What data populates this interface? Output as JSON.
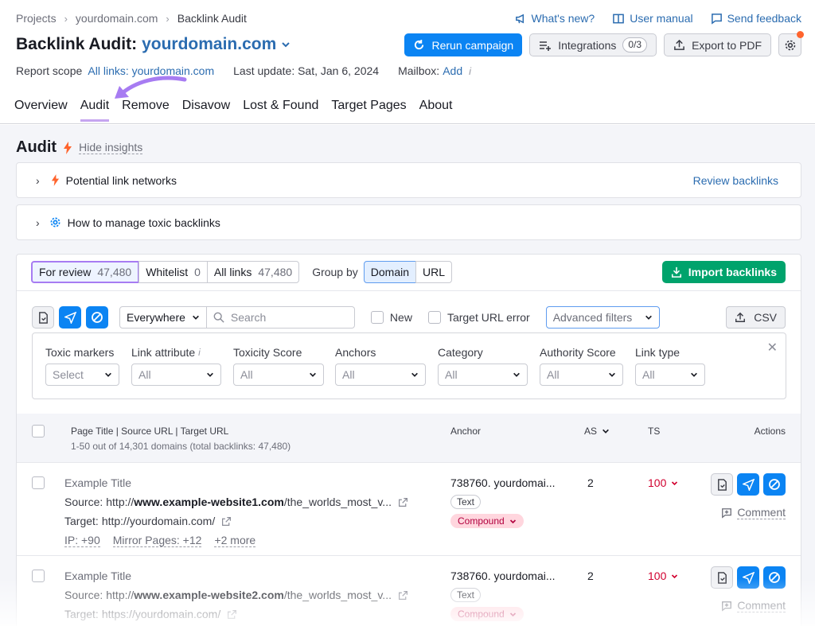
{
  "breadcrumb": [
    "Projects",
    "yourdomain.com",
    "Backlink Audit"
  ],
  "top_links": {
    "whats_new": "What's new?",
    "manual": "User manual",
    "feedback": "Send feedback"
  },
  "title": {
    "prefix": "Backlink Audit:",
    "domain": "yourdomain.com"
  },
  "buttons": {
    "rerun": "Rerun campaign",
    "integrations": "Integrations",
    "integrations_badge": "0/3",
    "export": "Export to PDF"
  },
  "scope": {
    "label": "Report scope",
    "value": "All links: yourdomain.com",
    "last_update": "Last update: Sat, Jan 6, 2024",
    "mailbox_label": "Mailbox:",
    "mailbox_value": "Add"
  },
  "tabs": [
    "Overview",
    "Audit",
    "Remove",
    "Disavow",
    "Lost & Found",
    "Target Pages",
    "About"
  ],
  "active_tab": "Audit",
  "audit": {
    "heading": "Audit",
    "hide_insights": "Hide insights"
  },
  "insights": {
    "networks": "Potential link networks",
    "review": "Review backlinks",
    "manage": "How to manage toxic backlinks"
  },
  "segments": [
    {
      "label": "For review",
      "count": "47,480"
    },
    {
      "label": "Whitelist",
      "count": "0"
    },
    {
      "label": "All links",
      "count": "47,480"
    }
  ],
  "group_by": {
    "label": "Group by",
    "options": [
      "Domain",
      "URL"
    ],
    "selected": "Domain"
  },
  "import_label": "Import backlinks",
  "toolbar": {
    "scope": "Everywhere",
    "search_placeholder": "Search",
    "new": "New",
    "target_error": "Target URL error",
    "advanced": "Advanced filters",
    "csv": "CSV"
  },
  "filters": [
    {
      "label": "Toxic markers",
      "value": "Select"
    },
    {
      "label": "Link attribute",
      "value": "All"
    },
    {
      "label": "Toxicity Score",
      "value": "All"
    },
    {
      "label": "Anchors",
      "value": "All"
    },
    {
      "label": "Category",
      "value": "All"
    },
    {
      "label": "Authority Score",
      "value": "All"
    },
    {
      "label": "Link type",
      "value": "All"
    }
  ],
  "table": {
    "col_page": "Page Title | Source URL | Target URL",
    "col_sub": "1-50 out of 14,301 domains (total backlinks: 47,480)",
    "col_anchor": "Anchor",
    "col_as": "AS",
    "col_ts": "TS",
    "col_actions": "Actions",
    "rows": [
      {
        "title": "Example Title",
        "source_label": "Source:",
        "source_pre": "http://",
        "source_bold": "www.example-website1.com",
        "source_post": "/the_worlds_most_v...",
        "target_label": "Target:",
        "target": "http://yourdomain.com/",
        "ip": "IP: +90",
        "mirror": "Mirror Pages: +12",
        "more": "+2 more",
        "anchor": "738760. yourdomai...",
        "tag": "Text",
        "marker": "Compound",
        "as": "2",
        "ts": "100",
        "comment": "Comment"
      },
      {
        "title": "Example Title",
        "source_label": "Source:",
        "source_pre": "http://",
        "source_bold": "www.example-website2.com",
        "source_post": "/the_worlds_most_v...",
        "target_label": "Target:",
        "target": "https://yourdomain.com/",
        "anchor": "738760. yourdomai...",
        "tag": "Text",
        "marker": "Compound",
        "as": "2",
        "ts": "100",
        "comment": "Comment"
      }
    ]
  },
  "colors": {
    "accent": "#0b84f3",
    "link": "#2b6cb0",
    "import": "#00a36c",
    "annotation": "#a77cf2",
    "toxic": "#d1002f",
    "notice": "#ff642d"
  }
}
